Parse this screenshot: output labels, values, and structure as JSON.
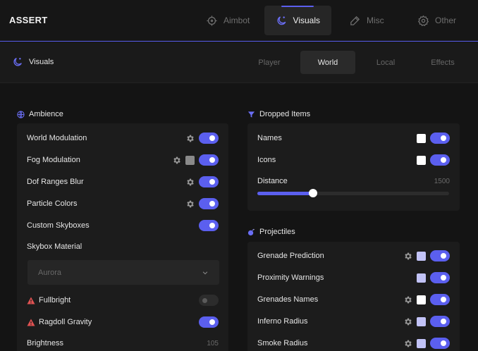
{
  "app": {
    "brand": "ASSERT",
    "accent": "#5b5fef"
  },
  "nav": {
    "tabs": [
      {
        "label": "Aimbot",
        "icon": "crosshair-icon",
        "active": false
      },
      {
        "label": "Visuals",
        "icon": "moon-stars-icon",
        "active": true
      },
      {
        "label": "Misc",
        "icon": "pen-icon",
        "active": false
      },
      {
        "label": "Other",
        "icon": "gear-icon",
        "active": false
      }
    ]
  },
  "subheader": {
    "title": "Visuals",
    "tabs": [
      "Player",
      "World",
      "Local",
      "Effects"
    ],
    "active_tab": "World"
  },
  "ambience": {
    "title": "Ambience",
    "rows": [
      {
        "label": "World Modulation",
        "gear": true,
        "toggle": true
      },
      {
        "label": "Fog Modulation",
        "gear": true,
        "swatch": "#8a8a8a",
        "toggle": true
      },
      {
        "label": "Dof Ranges Blur",
        "gear": true,
        "toggle": true
      },
      {
        "label": "Particle Colors",
        "gear": true,
        "toggle": true
      },
      {
        "label": "Custom Skyboxes",
        "toggle": true
      },
      {
        "label": "Skybox Material"
      },
      {
        "label": "Fullbright",
        "warning": true,
        "toggle": false
      },
      {
        "label": "Ragdoll Gravity",
        "warning": true,
        "toggle": true
      },
      {
        "label": "Brightness",
        "value": "105"
      }
    ],
    "skybox_select": {
      "value": "Aurora"
    }
  },
  "dropped_items": {
    "title": "Dropped Items",
    "rows": [
      {
        "label": "Names",
        "swatch": "#ffffff",
        "toggle": true
      },
      {
        "label": "Icons",
        "swatch": "#ffffff",
        "toggle": true
      }
    ],
    "distance": {
      "label": "Distance",
      "value": "1500",
      "fraction": 0.29
    }
  },
  "projectiles": {
    "title": "Projectiles",
    "rows": [
      {
        "label": "Grenade Prediction",
        "gear": true,
        "swatch": "#c2c3f7",
        "toggle": true
      },
      {
        "label": "Proximity Warnings",
        "swatch": "#c2c3f7",
        "toggle": true
      },
      {
        "label": "Grenades Names",
        "gear": true,
        "swatch": "#ffffff",
        "toggle": true
      },
      {
        "label": "Inferno Radius",
        "gear": true,
        "swatch": "#c2c3f7",
        "toggle": true
      },
      {
        "label": "Smoke Radius",
        "gear": true,
        "swatch": "#c2c3f7",
        "toggle": true
      }
    ]
  }
}
